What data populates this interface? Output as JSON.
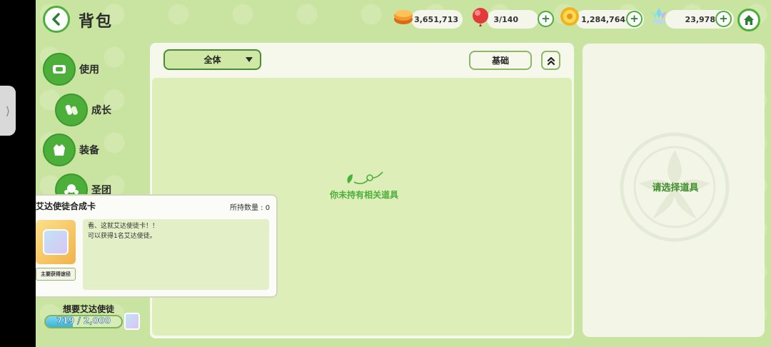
{
  "header": {
    "title": "背包"
  },
  "resources": [
    {
      "icon": "gold-coin-stack-icon",
      "value": "3,651,713",
      "has_plus": false
    },
    {
      "icon": "red-candy-icon",
      "value": "3/140",
      "has_plus": true
    },
    {
      "icon": "yellow-coin-icon",
      "value": "1,284,764",
      "has_plus": true
    },
    {
      "icon": "crystal-gem-icon",
      "value": "23,978",
      "has_plus": true
    }
  ],
  "sidebar": {
    "items": [
      {
        "label": "使用",
        "icon": "use-icon"
      },
      {
        "label": "成长",
        "icon": "growth-icon"
      },
      {
        "label": "装备",
        "icon": "equipment-icon"
      },
      {
        "label": "圣团",
        "icon": "group-icon"
      }
    ]
  },
  "filter": {
    "selected": "全体",
    "basic_label": "基础"
  },
  "main": {
    "empty_text": "你未持有相关道具"
  },
  "detail": {
    "placeholder": "请选择道具"
  },
  "tooltip": {
    "title": "艾达使徒合成卡",
    "count_label": "所持数量 : 0",
    "desc_line1": "看、这就艾达使徒卡！！",
    "desc_line2": "可以获得1名艾达使徒。",
    "source_label": "主要获得途径"
  },
  "progress": {
    "label": "想要艾达使徒",
    "text": "719 / 2,000",
    "current": 719,
    "max": 2000
  },
  "colors": {
    "accent": "#4caf3a",
    "bg": "#c9e4a0",
    "text_green": "#3f8f2b"
  }
}
